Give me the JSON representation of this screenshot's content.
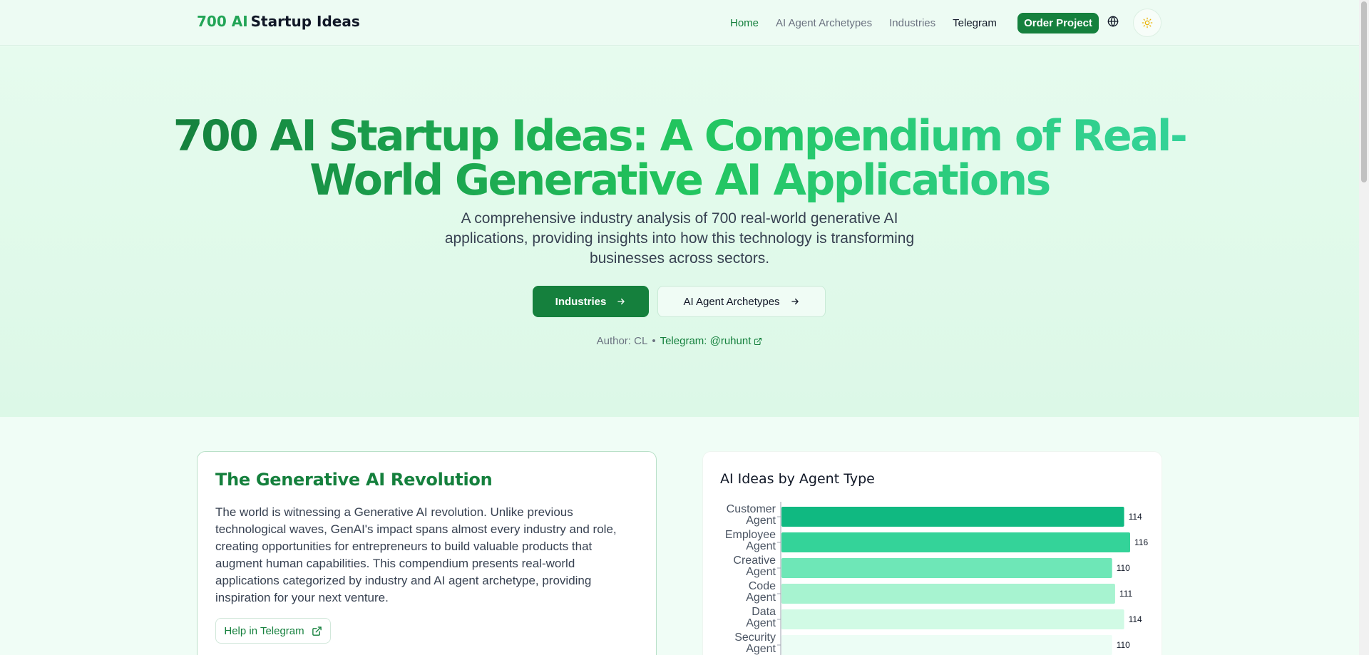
{
  "nav": {
    "brand_accent": "700 AI",
    "brand_rest": "Startup Ideas",
    "links": [
      {
        "label": "Home"
      },
      {
        "label": "AI Agent Archetypes"
      },
      {
        "label": "Industries"
      },
      {
        "label": "Telegram"
      }
    ],
    "order_label": "Order Project",
    "icons": {
      "language": "globe-icon",
      "theme": "sun-icon"
    }
  },
  "hero": {
    "title": "700 AI Startup Ideas: A Compendium of Real-World Generative AI Applications",
    "subtitle": "A comprehensive industry analysis of 700 real-world generative AI applications, providing insights into how this technology is transforming businesses across sectors.",
    "primary_button": "Industries",
    "secondary_button": "AI Agent Archetypes",
    "author": "Author: CL",
    "separator": "•",
    "telegram": "Telegram: @ruhunt"
  },
  "revolution": {
    "heading": "The Generative AI Revolution",
    "body": "The world is witnessing a Generative AI revolution. Unlike previous technological waves, GenAI's impact spans almost every industry and role, creating opportunities for entrepreneurs to build valuable products that augment human capabilities. This compendium presents real-world applications categorized by industry and AI agent archetype, providing inspiration for your next venture.",
    "help_button": "Help in Telegram"
  },
  "chart_card": {
    "title": "AI Ideas by Agent Type"
  },
  "chart_data": {
    "type": "bar",
    "orientation": "horizontal",
    "title": "AI Ideas by Agent Type",
    "categories": [
      "Customer Agent",
      "Employee Agent",
      "Creative Agent",
      "Code Agent",
      "Data Agent",
      "Security Agent"
    ],
    "label_lines": [
      [
        "Customer",
        "Agent"
      ],
      [
        "Employee",
        "Agent"
      ],
      [
        "Creative",
        "Agent"
      ],
      [
        "Code",
        "Agent"
      ],
      [
        "Data",
        "Agent"
      ],
      [
        "Security",
        "Agent"
      ]
    ],
    "values": [
      114,
      116,
      110,
      111,
      114,
      110
    ],
    "colors": [
      "#10b981",
      "#34d399",
      "#6ee7b7",
      "#a7f3d0",
      "#d1fae5",
      "#ecfdf5"
    ],
    "xlim": [
      0,
      116
    ],
    "grid": false
  },
  "colors": {
    "brand": "#15803d",
    "accent": "#22c55e",
    "hero_bg": "#e6fbee"
  }
}
